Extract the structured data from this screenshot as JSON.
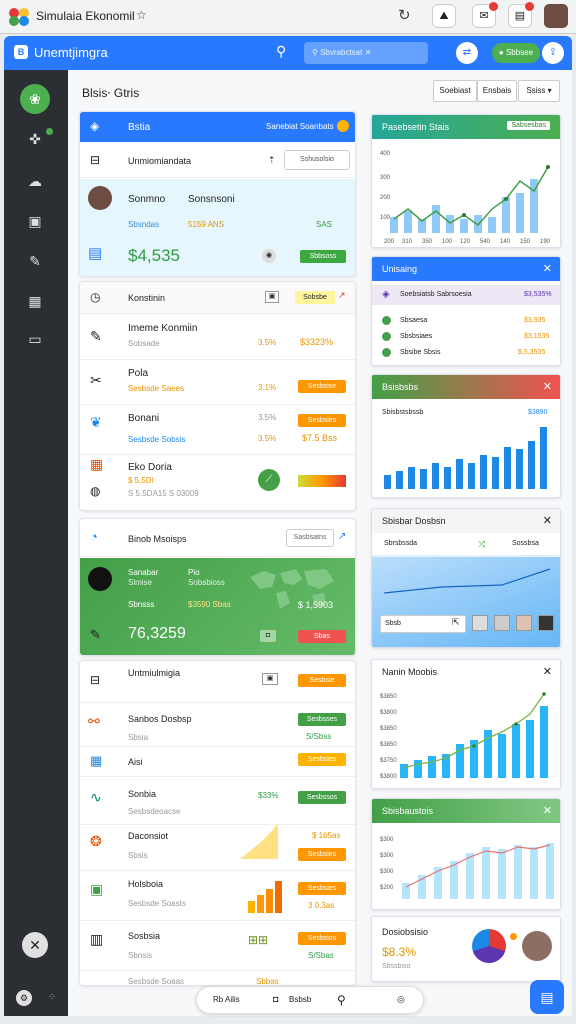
{
  "browser": {
    "tab_title": "Simulaia Ekonomil",
    "star": "☆",
    "reload": "↻"
  },
  "appbar": {
    "title": "Unemtjimgra",
    "search_placeholder": "Sbvrabctsat",
    "button_label": "Sbbsee"
  },
  "page": {
    "title": "Blsis⸱ Gtris",
    "buttons": [
      "Soebiast",
      "Ensbais",
      "Ssiss"
    ]
  },
  "main_card": {
    "title": "Bstia",
    "head_action": "Sanebiat Soanbats",
    "subtitle": "Unmiomiandata",
    "filter_placeholder": "Sshusolsio",
    "profile_name": "Sonmno",
    "profile_role": "Sonsnsoni",
    "stat_left": "Sbsndas",
    "stat_mid": "5159 ANS",
    "stat_right": "SAS",
    "amount": "$4,535",
    "amount_button": "Sbbsoss"
  },
  "list_card": {
    "header": "Konstinin",
    "header_tag": "Sobsbe",
    "items": [
      {
        "title": "Imeme Konmiin",
        "sub": "Sobsade",
        "pct": "3.5%",
        "value": "$3323%"
      },
      {
        "title": "Pola",
        "sub": "Sesbsde Saees",
        "pct": "3.1%",
        "value": "Sesbsies"
      },
      {
        "title": "Bonani",
        "sub": "Sesbsde Sobsis",
        "pct": "3.5%",
        "value": "$7.5 Bss"
      },
      {
        "title": "Eko Doria",
        "sub": "$ 5.5DI",
        "sub2": "S 5.5DA15 S 03009"
      }
    ],
    "item_pills": [
      "Sesbsise",
      "Sesbsies",
      "Sesbsia"
    ]
  },
  "green_card": {
    "header": "Binob Msoisps",
    "filter": "Sasbsatns",
    "label1": "Sanabar",
    "label1b": "Slmise",
    "label2": "Pio",
    "label2b": "Sobsbioss",
    "stat_left": "Sbnsss",
    "stat_mid": "$3590 Sbas",
    "stat_right": "$ 1,5903",
    "big_value": "76,3259",
    "button": "Sbas"
  },
  "feed_card": {
    "items": [
      {
        "title": "Untmiulmigia",
        "button": "Sesbsie"
      },
      {
        "title": "Sanbos Dosbsp",
        "sub": "Sbsia",
        "button": "Sesbsses",
        "value": "S/Sbss"
      },
      {
        "title": "Aisi",
        "button": "Sesbsies"
      },
      {
        "title": "Sonbia",
        "pct": "$33%",
        "sub": "Sesbsdeoacse",
        "button": "Sesbssos"
      },
      {
        "title": "Daconsiot",
        "sub": "Sbsis",
        "button": "Sesbsies",
        "value": "$ 1b5as"
      },
      {
        "title": "Holsboia",
        "sub": "Sesbsde Soasts",
        "button": "Sesbsies",
        "value": "3 0.3as"
      },
      {
        "title": "Sosbsia",
        "sub": "Sbnsis",
        "button": "Sesbsios",
        "value": "S/Sbas"
      },
      {
        "title": "Sesbsde Soaas",
        "value": "Sbbas"
      }
    ]
  },
  "right": {
    "c1": {
      "title": "Pasebsetin Stais",
      "action": "Sabsesbas",
      "y_ticks": [
        "400",
        "300",
        "200",
        "100",
        "0"
      ],
      "x_ticks": [
        "200",
        "310",
        "350",
        "100",
        "120",
        "540",
        "140",
        "150",
        "190"
      ]
    },
    "c2": {
      "title": "Unisaing",
      "rows": [
        {
          "l": "Soebsiatsb Sabrsoesia",
          "v": "$3,535%"
        },
        {
          "l": "Sbsaesa",
          "v": "$3,935"
        },
        {
          "l": "Sbsbsiaes",
          "v": "$3,1535"
        },
        {
          "l": "Sbsibe Sbsis",
          "v": "$,5,3535"
        }
      ]
    },
    "c3": {
      "title": "Bsisbsbs",
      "subtitle": "Sbisbstsbssb",
      "value": "$3890"
    },
    "c4": {
      "title": "Sbisbar Dosbsn",
      "sub1": "Sbrsbssda",
      "sub2": "Sossbsa",
      "subfield": "Sbsb"
    },
    "c5": {
      "title": "Nanin Moobis",
      "y_ticks": [
        "$3850",
        "$3800",
        "$3850",
        "$3850",
        "$3750",
        "$3800",
        "$3900"
      ]
    },
    "c6": {
      "title": "Sbisbaustois",
      "y_ticks": [
        "$300",
        "$300",
        "$300",
        "$200",
        "$100"
      ]
    },
    "c7": {
      "title": "Dosiobsisio",
      "value": "$8.3%",
      "sub": "Sbssbiso"
    }
  },
  "bottom": {
    "left": "Rb Ailis",
    "mid": "Bsbsb"
  },
  "colors": {
    "accent": "#2979ff",
    "green": "#4caf50",
    "orange": "#ff9800",
    "sidebar": "#2b2f33"
  }
}
